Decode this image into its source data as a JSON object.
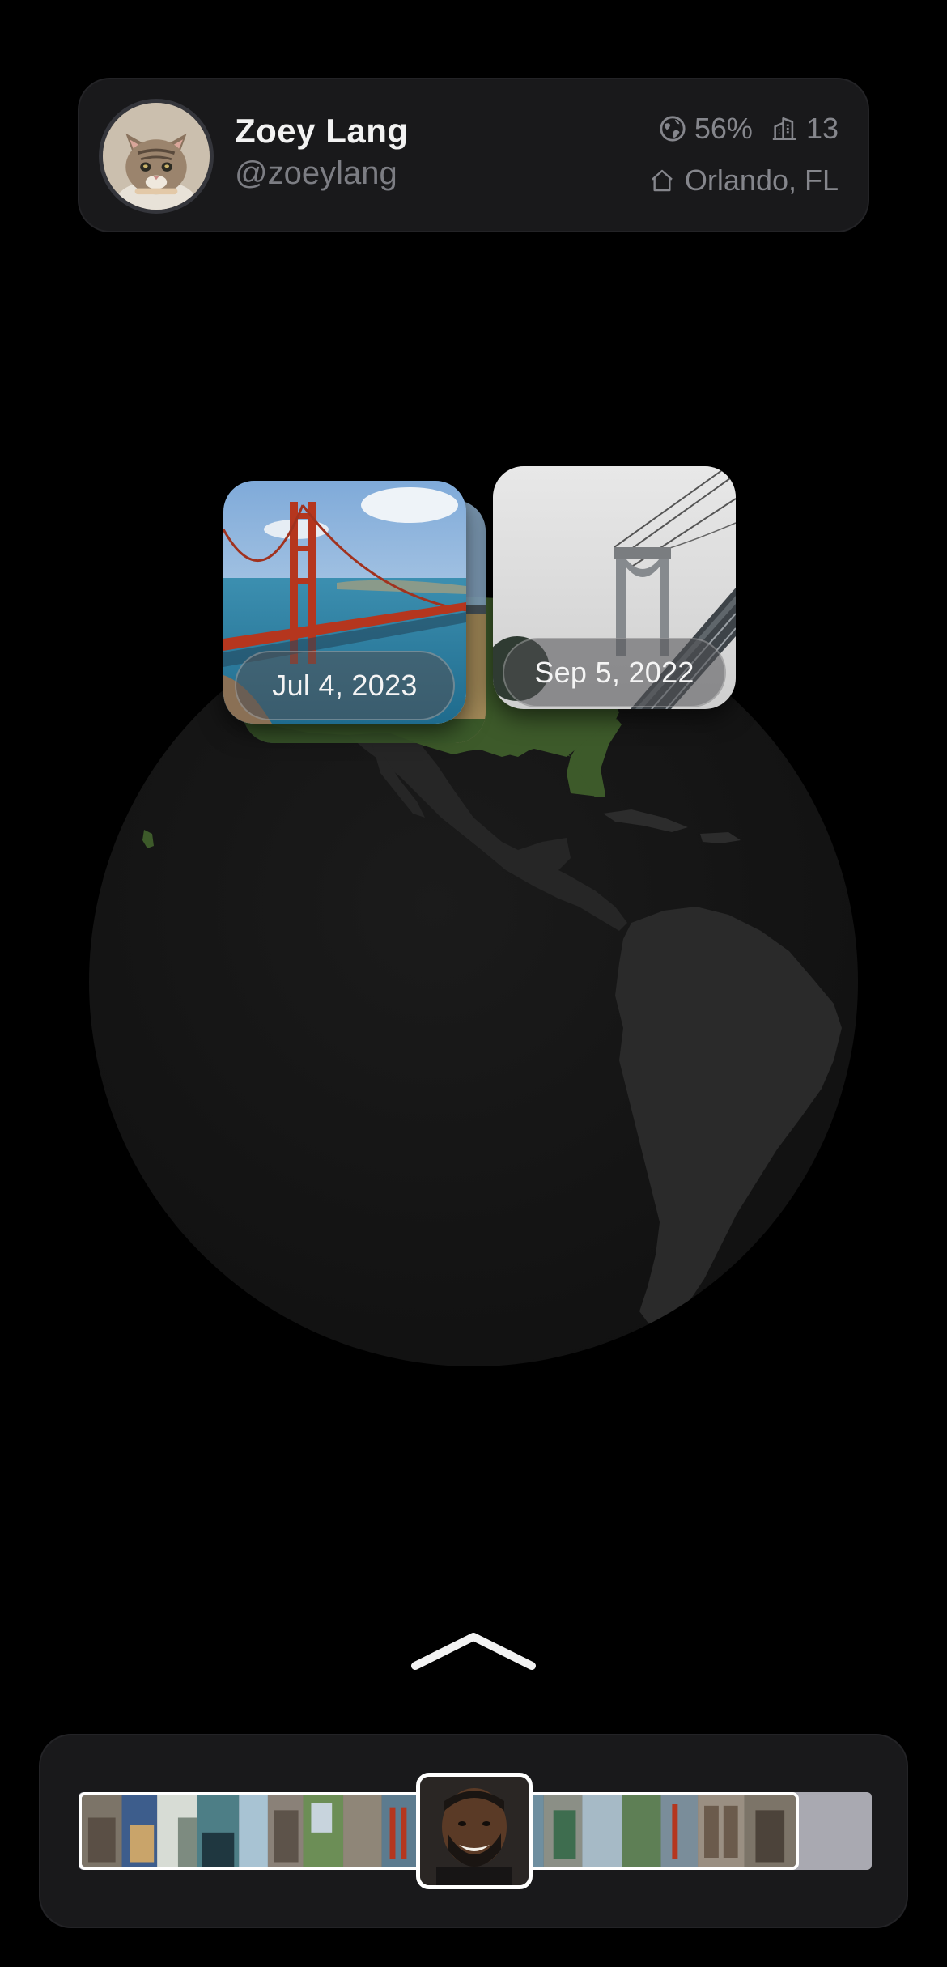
{
  "profile": {
    "name": "Zoey Lang",
    "handle": "@zoeylang",
    "globe_percent": "56%",
    "cities_count": "13",
    "home_location": "Orlando, FL",
    "icons": {
      "globe": "globe-icon",
      "buildings": "buildings-icon",
      "home": "home-icon",
      "avatar": "cat-avatar"
    }
  },
  "map": {
    "highlight_color": "#3d5a2a",
    "land_color": "#262626",
    "ocean_color": "#141414"
  },
  "pins": [
    {
      "date": "Jul 4, 2023",
      "subject": "Golden Gate Bridge"
    },
    {
      "date": "Sep 5, 2022",
      "subject": "Manhattan Bridge"
    }
  ],
  "controls": {
    "expand_icon": "chevron-up-icon"
  },
  "timeline": {
    "current_thumb": "portrait-photo"
  }
}
